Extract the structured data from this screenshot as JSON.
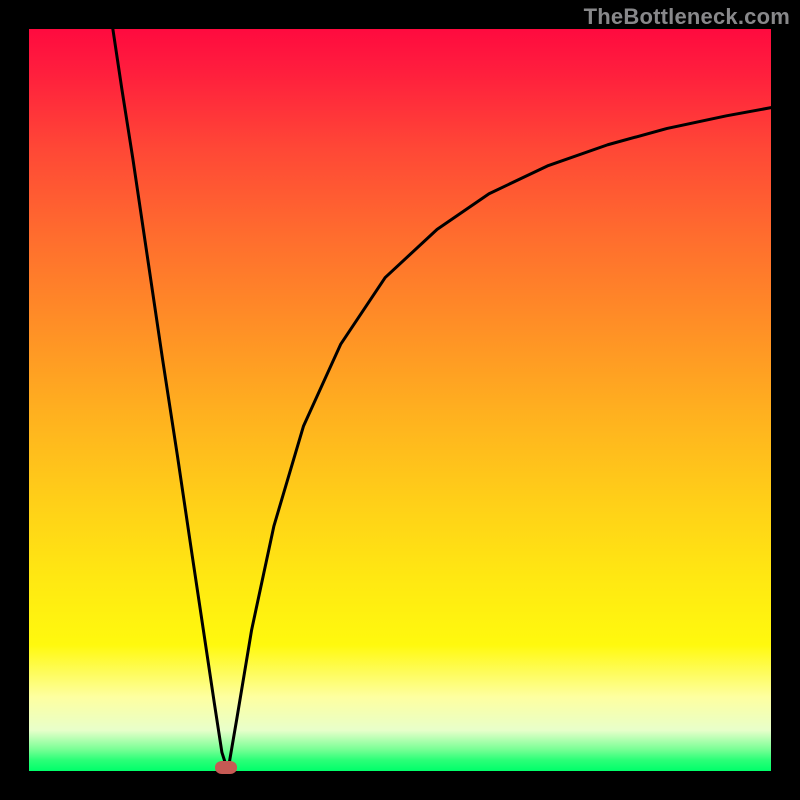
{
  "watermark": "TheBottleneck.com",
  "colors": {
    "frame": "#000000",
    "top": "#ff0a3f",
    "mid_orange": "#ff8f26",
    "yellow": "#ffe812",
    "pale": "#feffa0",
    "green": "#00ff6a",
    "curve": "#000000",
    "marker": "#c65a54",
    "watermark_text": "#88888a"
  },
  "chart_data": {
    "type": "line",
    "title": "",
    "xlabel": "",
    "ylabel": "",
    "xlim": [
      0,
      100
    ],
    "ylim": [
      0,
      100
    ],
    "series": [
      {
        "name": "left-branch",
        "x": [
          11.3,
          12.5,
          14.0,
          16.0,
          18.0,
          20.0,
          22.0,
          23.5,
          25.0,
          26.0,
          26.8
        ],
        "values": [
          100.0,
          92.0,
          82.5,
          69.0,
          55.5,
          42.5,
          29.0,
          19.0,
          9.0,
          2.5,
          0.0
        ]
      },
      {
        "name": "right-branch",
        "x": [
          26.8,
          28.0,
          30.0,
          33.0,
          37.0,
          42.0,
          48.0,
          55.0,
          62.0,
          70.0,
          78.0,
          86.0,
          94.0,
          100.0
        ],
        "values": [
          0.0,
          7.0,
          19.0,
          33.0,
          46.5,
          57.5,
          66.5,
          73.0,
          77.8,
          81.6,
          84.4,
          86.6,
          88.3,
          89.4
        ]
      }
    ],
    "marker": {
      "x": 26.5,
      "y": 0.5
    },
    "grid": false,
    "legend": false
  }
}
